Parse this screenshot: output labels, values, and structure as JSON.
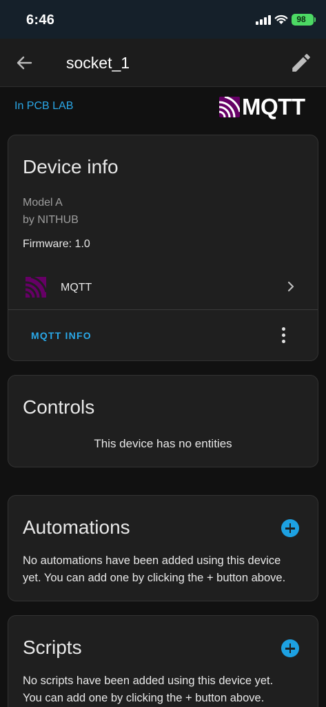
{
  "status_bar": {
    "time": "6:46",
    "battery": "98"
  },
  "app_bar": {
    "title": "socket_1"
  },
  "area": {
    "label": "In PCB LAB"
  },
  "brand": {
    "logo_text": "MQTT"
  },
  "device_info": {
    "title": "Device info",
    "model": "Model A",
    "manufacturer": "by NITHUB",
    "firmware": "Firmware: 1.0",
    "integration_label": "MQTT",
    "action_label": "MQTT INFO"
  },
  "controls": {
    "title": "Controls",
    "empty_text": "This device has no entities"
  },
  "automations": {
    "title": "Automations",
    "empty_line1": "No automations have been added using this device",
    "empty_line2": "yet. You can add one by clicking the + button above."
  },
  "scripts": {
    "title": "Scripts",
    "empty_line1": "No scripts have been added using this device yet.",
    "empty_line2": "You can add one by clicking the + button above."
  },
  "colors": {
    "accent": "#2aa8e8",
    "add_button": "#1da1e2",
    "brand_purple": "#660066",
    "card": "#1f1f1f",
    "background": "#111111"
  },
  "icons": {
    "back": "arrow-left-icon",
    "edit": "pencil-icon",
    "integration": "mqtt-icon",
    "chevron": "chevron-right-icon",
    "overflow": "dots-vertical-icon",
    "add": "plus-circle-icon"
  }
}
